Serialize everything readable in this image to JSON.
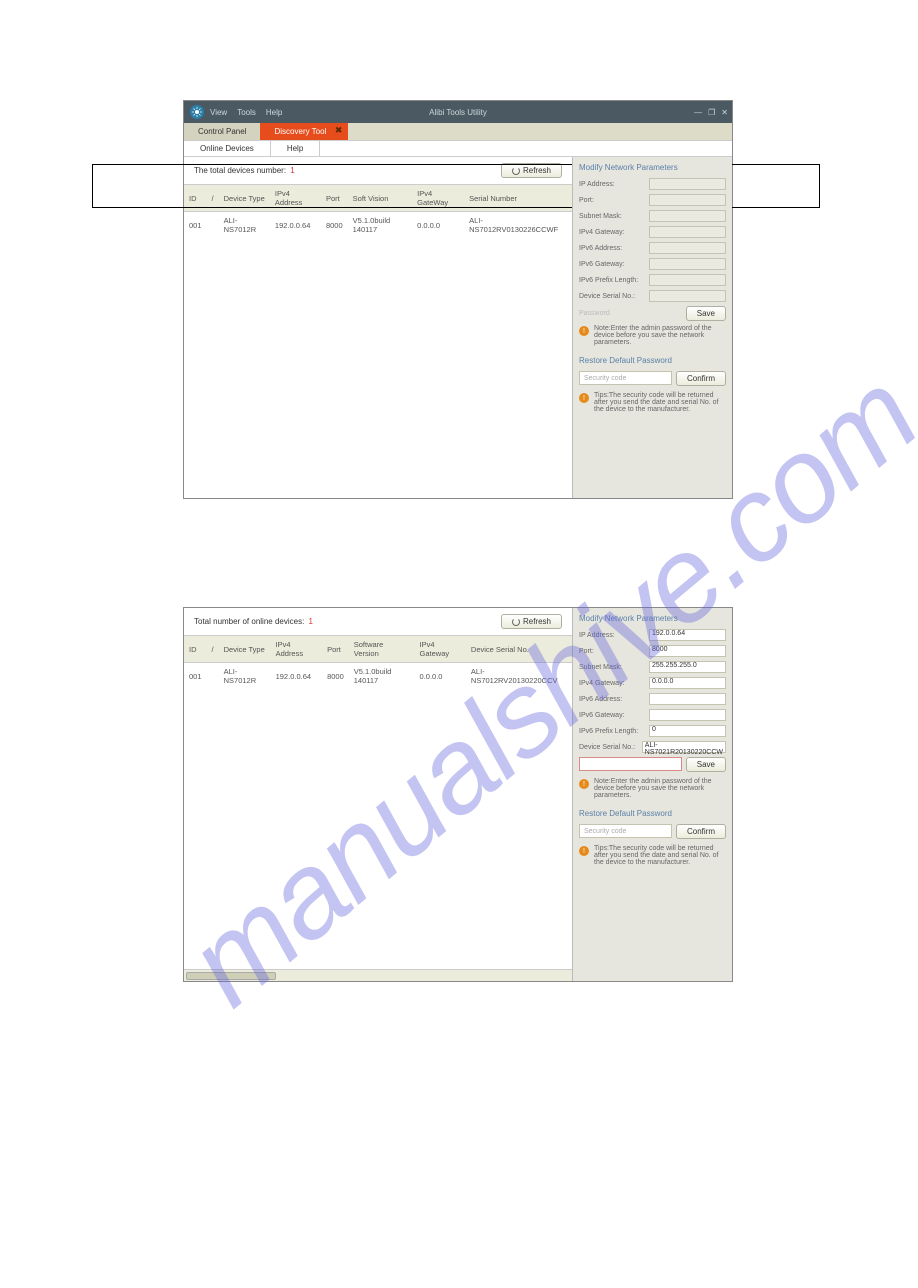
{
  "watermark_text": "manualshive.com",
  "app1": {
    "title": "Alibi Tools Utility",
    "menu": {
      "view": "View",
      "tools": "Tools",
      "help": "Help"
    },
    "main_tabs": {
      "control_panel": "Control Panel",
      "discovery_tool": "Discovery Tool"
    },
    "sub_tabs": {
      "online_devices": "Online Devices",
      "help": "Help"
    },
    "count_label": "The total devices number:",
    "count_value": "1",
    "refresh_label": "Refresh",
    "table": {
      "headers": {
        "id": "ID",
        "device_type": "Device Type",
        "ipv4_addr": "IPv4 Address",
        "port": "Port",
        "soft_version": "Soft Vision",
        "ipv4_gateway": "IPv4 GateWay",
        "serial": "Serial Number"
      },
      "row": {
        "id": "001",
        "device_type": "ALI-NS7012R",
        "ipv4_addr": "192.0.0.64",
        "port": "8000",
        "soft_version": "V5.1.0build 140117",
        "ipv4_gateway": "0.0.0.0",
        "serial": "ALI-NS7012RV0130226CCWF"
      }
    },
    "panel": {
      "title": "Modify Network Parameters",
      "fields": {
        "ip_address": "IP Address:",
        "port": "Port:",
        "subnet_mask": "Subnet Mask:",
        "ipv4_gateway": "IPv4 Gateway:",
        "ipv6_address": "IPv6 Address:",
        "ipv6_gateway": "IPv6 Gateway:",
        "ipv6_prefix": "IPv6 Prefix Length:",
        "device_serial": "Device Serial No.:"
      },
      "password_label": "Password",
      "save_label": "Save",
      "note1": "Note:Enter the admin password of the device before you save the network parameters.",
      "restore_title": "Restore Default Password",
      "security_placeholder": "Security code",
      "confirm_label": "Confirm",
      "tips": "Tips:The security code will be returned after you send the date and serial No. of the device to the manufacturer."
    }
  },
  "app2": {
    "count_label": "Total number of online devices:",
    "count_value": "1",
    "refresh_label": "Refresh",
    "table": {
      "headers": {
        "id": "ID",
        "device_type": "Device Type",
        "ipv4_addr": "IPv4 Address",
        "port": "Port",
        "soft_version": "Software Version",
        "ipv4_gateway": "IPv4 Gateway",
        "serial": "Device Serial No."
      },
      "row": {
        "id": "001",
        "device_type": "ALI-NS7012R",
        "ipv4_addr": "192.0.0.64",
        "port": "8000",
        "soft_version": "V5.1.0build 140117",
        "ipv4_gateway": "0.0.0.0",
        "serial": "ALI-NS7012RV20130220CCV"
      }
    },
    "panel": {
      "title": "Modify Network Parameters",
      "fields": {
        "ip_address": {
          "label": "IP Address:",
          "value": "192.0.0.64"
        },
        "port": {
          "label": "Port:",
          "value": "8000"
        },
        "subnet_mask": {
          "label": "Subnet Mask:",
          "value": "255.255.255.0"
        },
        "ipv4_gateway": {
          "label": "IPv4 Gateway:",
          "value": "0.0.0.0"
        },
        "ipv6_address": {
          "label": "IPv6 Address:",
          "value": ""
        },
        "ipv6_gateway": {
          "label": "IPv6 Gateway:",
          "value": ""
        },
        "ipv6_prefix": {
          "label": "IPv6 Prefix Length:",
          "value": "0"
        },
        "device_serial": {
          "label": "Device Serial No.:",
          "value": "ALI-NS7021R20130220CCW"
        }
      },
      "save_label": "Save",
      "note1": "Note:Enter the admin password of the device before you save the network parameters.",
      "restore_title": "Restore Default Password",
      "security_placeholder": "Security code",
      "confirm_label": "Confirm",
      "tips": "Tips:The security code will be returned after you send the date and serial No. of the device to the manufacturer."
    }
  }
}
